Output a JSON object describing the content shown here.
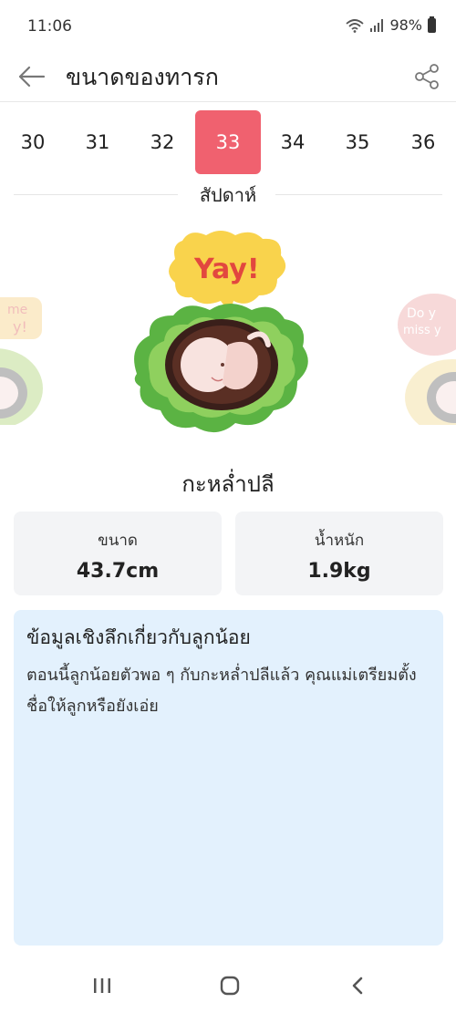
{
  "status_bar": {
    "time": "11:06",
    "battery": "98%"
  },
  "app_bar": {
    "title": "ขนาดของทารก",
    "back_icon": "arrow-left-icon",
    "share_icon": "share-icon"
  },
  "weeks": {
    "items": [
      "30",
      "31",
      "32",
      "33",
      "34",
      "35",
      "36"
    ],
    "selected": "33",
    "caption": "สัปดาห์"
  },
  "illustrations": {
    "main_bubble": "Yay!",
    "left_bubble": "me\ny!",
    "right_bubble": "Do y\nmiss y"
  },
  "fruit_name": "กะหล่ำปลี",
  "stats": {
    "size_label": "ขนาด",
    "size_value": "43.7cm",
    "weight_label": "น้ำหนัก",
    "weight_value": "1.9kg"
  },
  "insight": {
    "title": "ข้อมูลเชิงลึกเกี่ยวกับลูกน้อย",
    "body": "ตอนนี้ลูกน้อยตัวพอ ๆ กับกะหล่ำปลีแล้ว คุณแม่เตรียมตั้งชื่อให้ลูกหรือยังเอ่ย"
  },
  "colors": {
    "accent": "#f0616f",
    "insight_bg": "#e3f1fd",
    "card_bg": "#f3f4f6",
    "cabbage": "#5bb343"
  },
  "nav": {
    "recents_icon": "recents-icon",
    "home_icon": "home-icon",
    "back_icon": "nav-back-icon"
  }
}
